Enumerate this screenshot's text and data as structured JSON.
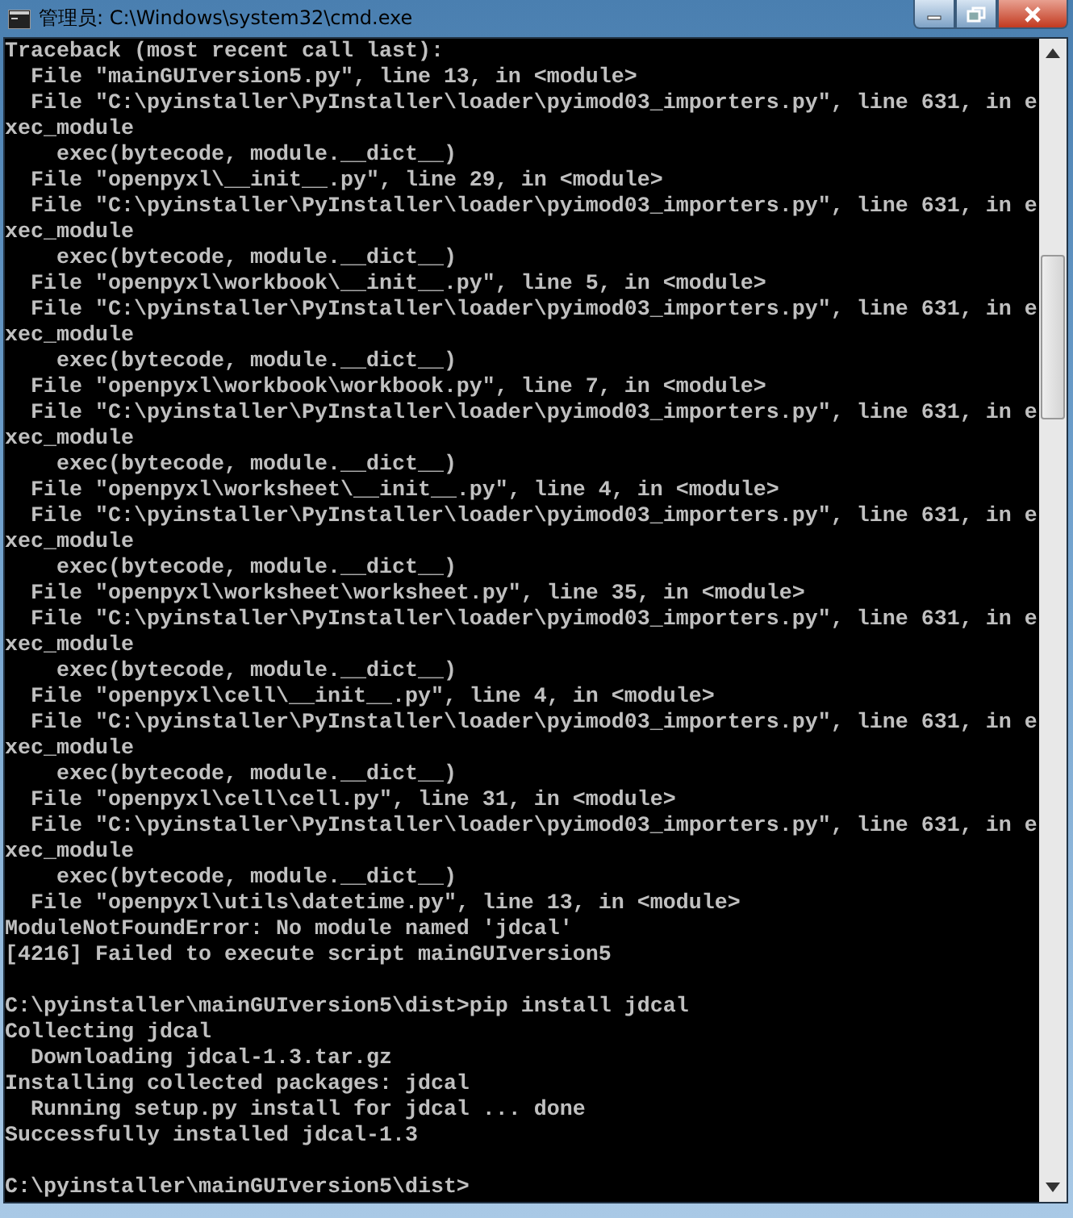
{
  "window": {
    "title": "管理员: C:\\Windows\\system32\\cmd.exe"
  },
  "console": {
    "blocks": [
      [
        "Traceback (most recent call last):",
        "  File \"mainGUIversion5.py\", line 13, in <module>",
        "  File \"C:\\pyinstaller\\PyInstaller\\loader\\pyimod03_importers.py\", line 631, in e",
        "xec_module",
        "    exec(bytecode, module.__dict__)",
        "  File \"openpyxl\\__init__.py\", line 29, in <module>",
        "  File \"C:\\pyinstaller\\PyInstaller\\loader\\pyimod03_importers.py\", line 631, in e",
        "xec_module",
        "    exec(bytecode, module.__dict__)",
        "  File \"openpyxl\\workbook\\__init__.py\", line 5, in <module>",
        "  File \"C:\\pyinstaller\\PyInstaller\\loader\\pyimod03_importers.py\", line 631, in e",
        "xec_module",
        "    exec(bytecode, module.__dict__)",
        "  File \"openpyxl\\workbook\\workbook.py\", line 7, in <module>",
        "  File \"C:\\pyinstaller\\PyInstaller\\loader\\pyimod03_importers.py\", line 631, in e",
        "xec_module",
        "    exec(bytecode, module.__dict__)",
        "  File \"openpyxl\\worksheet\\__init__.py\", line 4, in <module>",
        "  File \"C:\\pyinstaller\\PyInstaller\\loader\\pyimod03_importers.py\", line 631, in e",
        "xec_module",
        "    exec(bytecode, module.__dict__)",
        "  File \"openpyxl\\worksheet\\worksheet.py\", line 35, in <module>",
        "  File \"C:\\pyinstaller\\PyInstaller\\loader\\pyimod03_importers.py\", line 631, in e",
        "xec_module",
        "    exec(bytecode, module.__dict__)",
        "  File \"openpyxl\\cell\\__init__.py\", line 4, in <module>",
        "  File \"C:\\pyinstaller\\PyInstaller\\loader\\pyimod03_importers.py\", line 631, in e",
        "xec_module",
        "    exec(bytecode, module.__dict__)",
        "  File \"openpyxl\\cell\\cell.py\", line 31, in <module>",
        "  File \"C:\\pyinstaller\\PyInstaller\\loader\\pyimod03_importers.py\", line 631, in e",
        "xec_module",
        "    exec(bytecode, module.__dict__)",
        "  File \"openpyxl\\utils\\datetime.py\", line 13, in <module>",
        "ModuleNotFoundError: No module named 'jdcal'",
        "[4216] Failed to execute script mainGUIversion5"
      ],
      [
        "C:\\pyinstaller\\mainGUIversion5\\dist>pip install jdcal",
        "Collecting jdcal",
        "  Downloading jdcal-1.3.tar.gz",
        "Installing collected packages: jdcal",
        "  Running setup.py install for jdcal ... done",
        "Successfully installed jdcal-1.3"
      ],
      [
        "C:\\pyinstaller\\mainGUIversion5\\dist>"
      ]
    ]
  }
}
